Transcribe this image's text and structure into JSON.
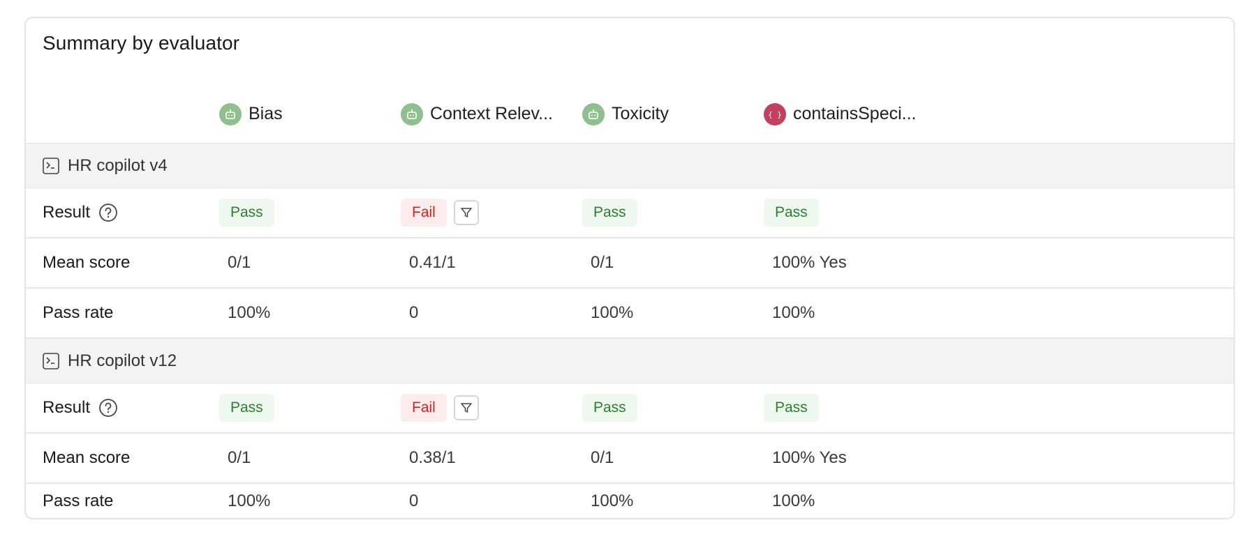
{
  "title": "Summary by evaluator",
  "colors": {
    "model_icon": "#8fbf8f",
    "code_icon": "#c2425e",
    "pass_bg": "#eef8ee",
    "pass_text": "#2e7d32",
    "fail_bg": "#fdecec",
    "fail_text": "#c62828",
    "group_bg": "#f3f3f3"
  },
  "evaluators": [
    {
      "name": "Bias",
      "icon": "robot-icon"
    },
    {
      "name": "Context Relev...",
      "icon": "robot-icon"
    },
    {
      "name": "Toxicity",
      "icon": "robot-icon"
    },
    {
      "name": "containsSpeci...",
      "icon": "code-braces-icon"
    }
  ],
  "row_labels": {
    "result": "Result",
    "mean_score": "Mean score",
    "pass_rate": "Pass rate"
  },
  "groups": [
    {
      "name": "HR copilot v4",
      "results": [
        "Pass",
        "Fail",
        "Pass",
        "Pass"
      ],
      "mean_scores": [
        "0/1",
        "0.41/1",
        "0/1",
        "100% Yes"
      ],
      "pass_rates": [
        "100%",
        "0",
        "100%",
        "100%"
      ]
    },
    {
      "name": "HR copilot v12",
      "results": [
        "Pass",
        "Fail",
        "Pass",
        "Pass"
      ],
      "mean_scores": [
        "0/1",
        "0.38/1",
        "0/1",
        "100% Yes"
      ],
      "pass_rates": [
        "100%",
        "0",
        "100%",
        "100%"
      ]
    }
  ]
}
